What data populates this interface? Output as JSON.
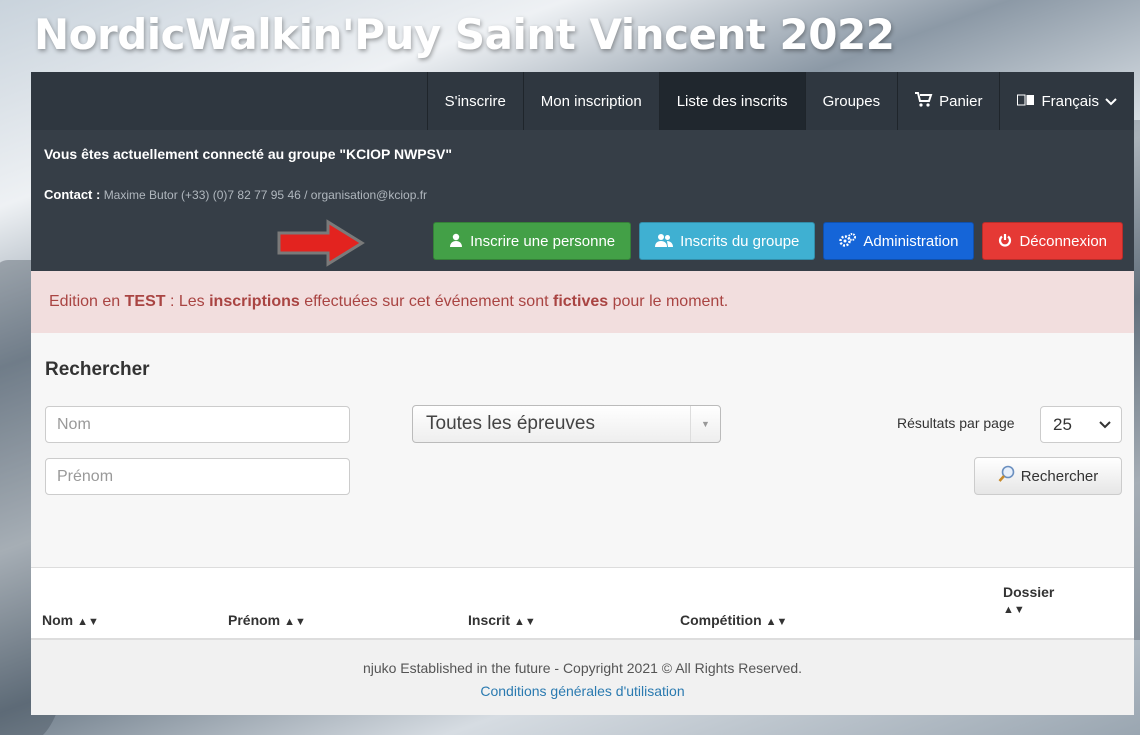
{
  "site_title": "NordicWalkin'Puy Saint Vincent 2022",
  "nav": {
    "register": "S'inscrire",
    "my_registration": "Mon inscription",
    "list": "Liste des inscrits",
    "groups": "Groupes",
    "cart": "Panier",
    "language": "Français"
  },
  "group": {
    "connected_text": "Vous êtes actuellement connecté au groupe \"KCIOP NWPSV\"",
    "contact_label": "Contact :",
    "contact_value": "Maxime Butor (+33) (0)7 82 77 95 46 / organisation@kciop.fr"
  },
  "actions": {
    "register_person": "Inscrire une personne",
    "group_members": "Inscrits du groupe",
    "administration": "Administration",
    "logout": "Déconnexion"
  },
  "alert": {
    "prefix": "Edition en",
    "test": "TEST",
    "middle1": ": Les",
    "registrations": "inscriptions",
    "middle2": "effectuées sur cet événement sont",
    "fictive": "fictives",
    "suffix": "pour le moment."
  },
  "search": {
    "heading": "Rechercher",
    "name_placeholder": "Nom",
    "firstname_placeholder": "Prénom",
    "events_selected": "Toutes les épreuves",
    "per_page_label": "Résultats par page",
    "per_page_value": "25",
    "search_button": "Rechercher"
  },
  "table": {
    "columns": [
      "Nom",
      "Prénom",
      "Inscrit",
      "Compétition",
      "Dossier"
    ]
  },
  "footer": {
    "copyright": "njuko Established in the future - Copyright 2021 © All Rights Reserved.",
    "terms": "Conditions générales d'utilisation"
  },
  "colors": {
    "navbar": "#2f3740",
    "green": "#43a047",
    "teal": "#3fb0d2",
    "blue": "#1565d8",
    "red": "#e53935",
    "alert_bg": "#f2dede",
    "alert_text": "#a94442"
  },
  "icons": {
    "cart": "cart-icon",
    "language": "language-icon",
    "user": "user-icon",
    "users": "users-icon",
    "cogs": "cogs-icon",
    "power": "power-icon",
    "magnifier": "magnifier-icon",
    "arrow": "red-arrow-icon"
  }
}
